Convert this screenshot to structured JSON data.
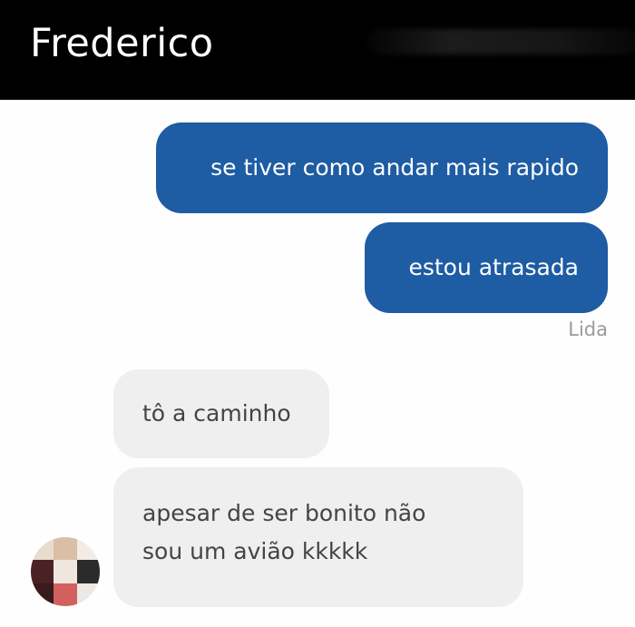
{
  "header": {
    "contact_name": "Frederico"
  },
  "messages": [
    {
      "direction": "outgoing",
      "text": "se tiver como andar mais rapido"
    },
    {
      "direction": "outgoing",
      "text": "estou atrasada"
    },
    {
      "direction": "incoming",
      "text": "tô a caminho"
    },
    {
      "direction": "incoming",
      "lines": [
        "apesar de ser bonito não",
        "sou um avião kkkkk"
      ]
    }
  ],
  "read_receipt": "Lida",
  "colors": {
    "header_bg": "#000000",
    "outgoing_bubble": "#1e5ca3",
    "incoming_bubble": "#efefef",
    "incoming_text": "#444444",
    "receipt_text": "#9a9a9a"
  },
  "avatar": {
    "icon": "pixelated-avatar-icon"
  }
}
